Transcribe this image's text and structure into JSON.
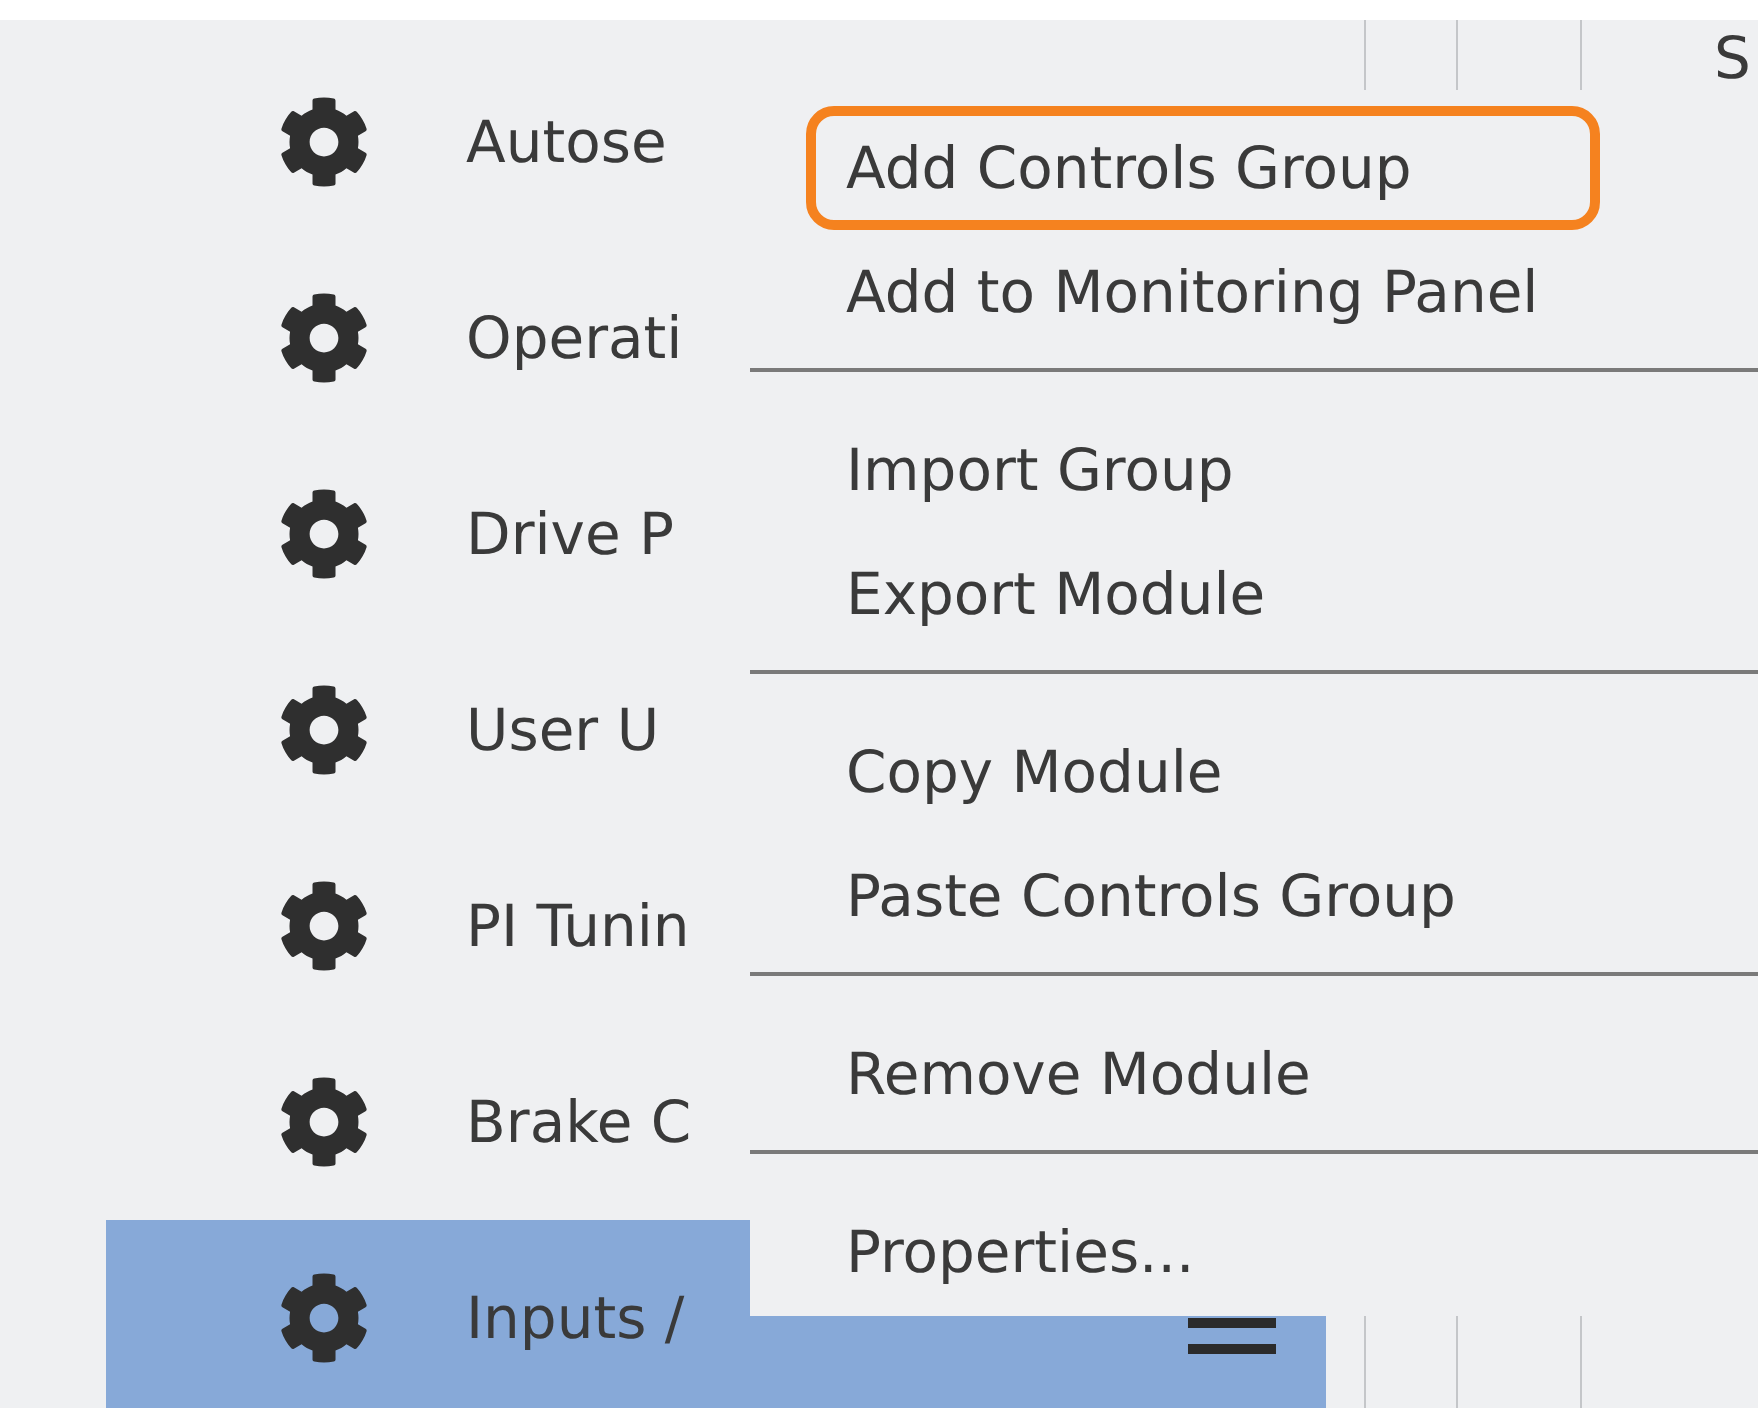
{
  "sidebar": {
    "items": [
      {
        "label": "Autose",
        "selected": false
      },
      {
        "label": "Operati",
        "selected": false
      },
      {
        "label": "Drive P",
        "selected": false
      },
      {
        "label": "User U",
        "selected": false
      },
      {
        "label": "PI Tunin",
        "selected": false
      },
      {
        "label": "Brake C",
        "selected": false
      },
      {
        "label": "Inputs /",
        "selected": true
      }
    ]
  },
  "columns": {
    "column_3": "S"
  },
  "context_menu": {
    "items": [
      {
        "kind": "item",
        "label": "Add Controls Group",
        "highlighted": true
      },
      {
        "kind": "item",
        "label": "Add to Monitoring Panel",
        "highlighted": false
      },
      {
        "kind": "separator"
      },
      {
        "kind": "item",
        "label": "Import Group",
        "highlighted": false
      },
      {
        "kind": "item",
        "label": "Export Module",
        "highlighted": false
      },
      {
        "kind": "separator"
      },
      {
        "kind": "item",
        "label": "Copy Module",
        "highlighted": false
      },
      {
        "kind": "item",
        "label": "Paste Controls Group",
        "highlighted": false
      },
      {
        "kind": "separator"
      },
      {
        "kind": "item",
        "label": "Remove Module",
        "highlighted": false
      },
      {
        "kind": "separator"
      },
      {
        "kind": "item",
        "label": "Properties...",
        "highlighted": false
      }
    ]
  }
}
